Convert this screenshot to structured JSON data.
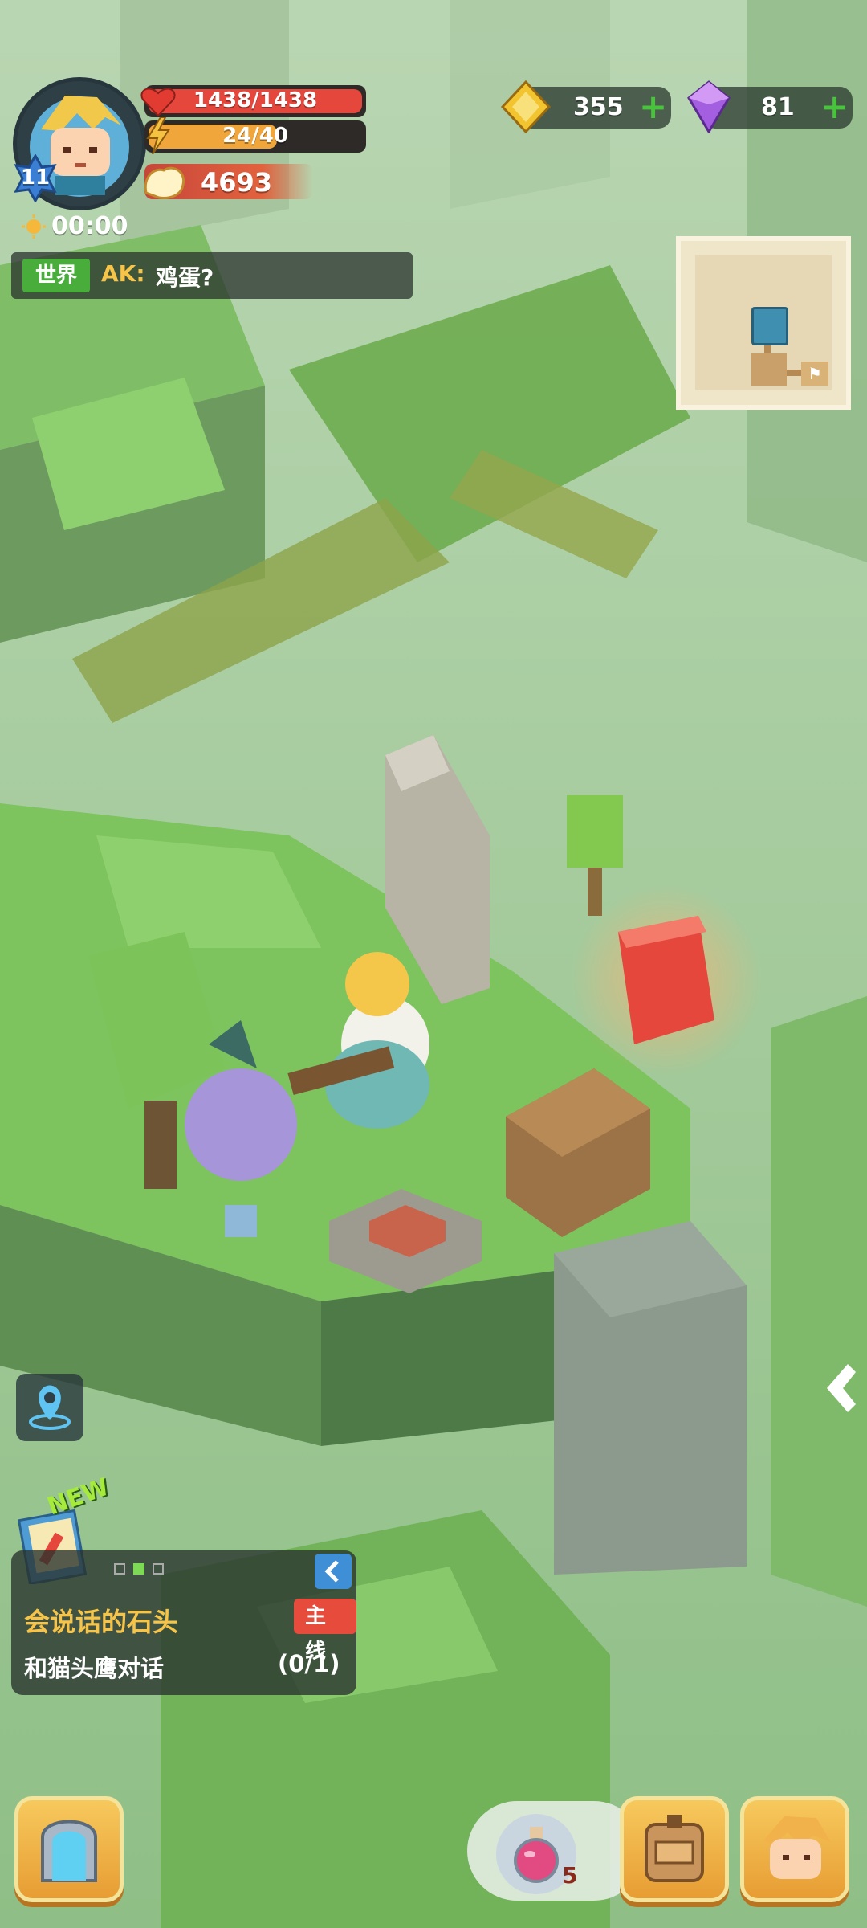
{
  "player": {
    "level": "11",
    "hp": "1438/1438",
    "energy": "24/40",
    "power": "4693",
    "timer": "00:00"
  },
  "currency": {
    "gold": "355",
    "gems": "81",
    "icons": {
      "gold": "gold-diamond-coin-icon",
      "gems": "purple-crystal-icon"
    }
  },
  "chat": {
    "channel": "世界",
    "speaker": "AK:",
    "message": "鸡蛋?"
  },
  "quest": {
    "new_badge": "NEW",
    "title": "会说话的石头",
    "tag": "主线",
    "task": "和猫头鹰对话",
    "progress": "(0/1)",
    "page_index": 2,
    "page_count": 3
  },
  "bottom_bar": {
    "potion_count": "5"
  },
  "colors": {
    "hp_bar": "#e5473d",
    "energy_bar": "#f0a63a",
    "quest_title": "#f7c44a",
    "main_tag": "#e74b3c",
    "accent_green": "#47c43c"
  }
}
